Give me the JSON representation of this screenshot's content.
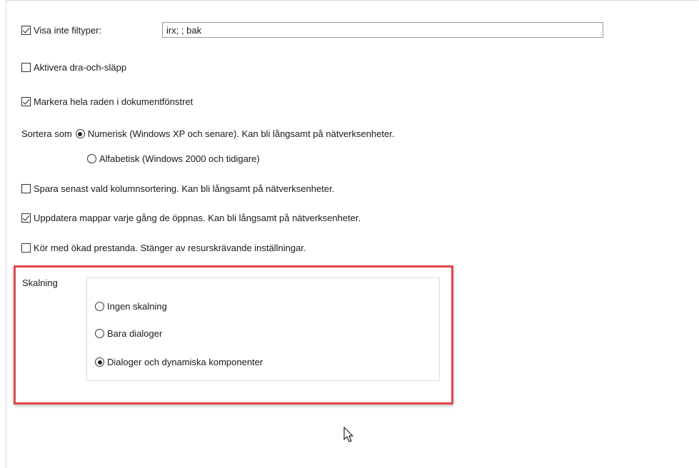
{
  "options": {
    "hide_filetypes_label": "Visa inte filtyper:",
    "hide_filetypes_value": "irx; ; bak",
    "drag_drop_label": "Aktivera dra-och-släpp",
    "highlight_row_label": "Markera hela raden i dokumentfönstret",
    "sort_as_label": "Sortera som",
    "sort_numeric_label": "Numerisk (Windows XP och senare). Kan bli långsamt på nätverksenheter.",
    "sort_alpha_label": "Alfabetisk (Windows 2000 och tidigare)",
    "save_sort_label": "Spara senast vald kolumnsortering. Kan bli långsamt på nätverksenheter.",
    "update_folders_label": "Uppdatera mappar varje gång de öppnas. Kan bli långsamt på nätverksenheter.",
    "performance_label": "Kör med ökad prestanda. Stänger av resurskrävande inställningar."
  },
  "checked": {
    "hide_filetypes": true,
    "drag_drop": false,
    "highlight_row": true,
    "sort": "numeric",
    "save_sort": false,
    "update_folders": true,
    "performance": false
  },
  "scaling": {
    "group_label": "Skalning",
    "options": [
      "Ingen skalning",
      "Bara dialoger",
      "Dialoger och dynamiska komponenter"
    ],
    "selected": "Dialoger och dynamiska komponenter"
  },
  "colors": {
    "highlight_border": "#e0474c"
  }
}
